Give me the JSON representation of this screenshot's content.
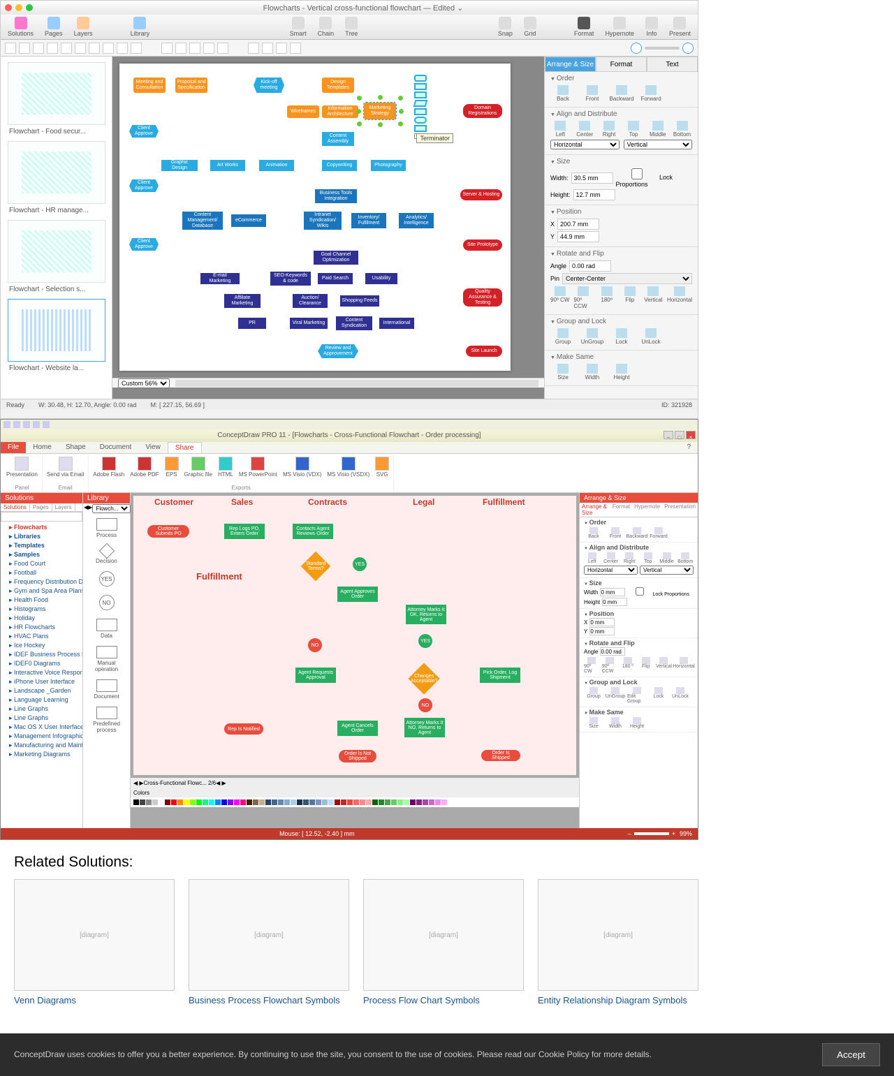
{
  "app1": {
    "title": "Flowcharts - Vertical cross-functional flowchart — Edited ⌄",
    "toolbar": [
      "Solutions",
      "Pages",
      "Layers",
      "Library",
      "Smart",
      "Chain",
      "Tree",
      "Snap",
      "Grid",
      "Format",
      "Hypernote",
      "Info",
      "Present"
    ],
    "thumbs": [
      "Flowchart - Food secur...",
      "Flowchart - HR manage...",
      "Flowchart - Selection s...",
      "Flowchart - Website la..."
    ],
    "tooltip": "Terminator",
    "rtabs": [
      "Arrange & Size",
      "Format",
      "Text"
    ],
    "panel": {
      "order": {
        "h": "Order",
        "btns": [
          "Back",
          "Front",
          "Backward",
          "Forward"
        ]
      },
      "align": {
        "h": "Align and Distribute",
        "btns": [
          "Left",
          "Center",
          "Right",
          "Top",
          "Middle",
          "Bottom"
        ],
        "h1": "Horizontal",
        "v1": "Vertical"
      },
      "size": {
        "h": "Size",
        "w": "Width:",
        "wv": "30.5 mm",
        "ht": "Height:",
        "hv": "12.7 mm",
        "lock": "Lock Proportions"
      },
      "pos": {
        "h": "Position",
        "x": "X",
        "xv": "200.7 mm",
        "y": "Y",
        "yv": "44.9 mm"
      },
      "rot": {
        "h": "Rotate and Flip",
        "a": "Angle",
        "av": "0.00 rad",
        "p": "Pin",
        "pv": "Center-Center",
        "btns": [
          "90º CW",
          "90º CCW",
          "180º",
          "Flip",
          "Vertical",
          "Horizontal"
        ]
      },
      "grp": {
        "h": "Group and Lock",
        "btns": [
          "Group",
          "UnGroup",
          "Lock",
          "UnLock"
        ]
      },
      "same": {
        "h": "Make Same",
        "btns": [
          "Size",
          "Width",
          "Height"
        ]
      }
    },
    "zoomcombo": "Custom 56%",
    "status": {
      "ready": "Ready",
      "dim": "W: 30.48,  H: 12.70,  Angle: 0.00 rad",
      "m": "M: [ 227.15, 56.69 ]",
      "id": "ID: 321928"
    },
    "nodes": {
      "r1": [
        "Meeting and Consultation",
        "Proposal and Specification",
        "Kick-off meeting",
        "Design Templates"
      ],
      "r2": [
        "Wireframes",
        "Information Architecture",
        "Marketing Strategy",
        "Domain Registrations"
      ],
      "ca1": "Client Approve",
      "ca2": "Client Approve",
      "ca3": "Client Approve",
      "content": "Content Assembly",
      "r3": [
        "Graphic Design",
        "Art Works",
        "Animation",
        "Copywriting",
        "Photography"
      ],
      "bti": "Business Tools Integration",
      "sh": "Server & Hosting",
      "r4": [
        "Content Management/ Database",
        "eCommerce",
        "Intranet Syndication/ Wikis",
        "Inventory/ Fulfilment",
        "Analytics/ Intelligence"
      ],
      "sp": "Site Prototype",
      "gco": "Goal Channel Optimization",
      "r5": [
        "E-mail Marketing",
        "SEO-Keywords & code",
        "Paid Search",
        "Usability"
      ],
      "qat": "Quality Assurance & Testing",
      "r6": [
        "Affiliate Marketing",
        "Auction/ Clearance",
        "Shopping Feeds"
      ],
      "r7": [
        "PR",
        "Viral Marketing",
        "Content Syndication",
        "International"
      ],
      "rev": "Review and Approvement",
      "sl": "Site Launch"
    }
  },
  "app2": {
    "title": "ConceptDraw PRO 11 - [Flowcharts - Cross-Functional Flowchart - Order processing]",
    "ribtabs": [
      "File",
      "Home",
      "Shape",
      "Document",
      "View",
      "Share"
    ],
    "ribbon": {
      "panel": [
        "Presentation",
        "Send via Email",
        "Adobe Flash",
        "Adobe PDF",
        "EPS",
        "Graphic file",
        "HTML",
        "MS PowerPoint",
        "MS Visio (VDX)",
        "MS Visio (VSDX)",
        "SVG"
      ],
      "groups": [
        "Panel",
        "Email",
        "Exports"
      ]
    },
    "solpane": {
      "h": "Solutions",
      "tabs": [
        "Solutions",
        "Pages",
        "Layers"
      ],
      "search": "",
      "tree": [
        "Flowcharts",
        "Libraries",
        "Templates",
        "Samples",
        "Food Court",
        "Football",
        "Frequency Distribution Dashboard",
        "Gym and Spa Area Plans",
        "Health Food",
        "Histograms",
        "Holiday",
        "HR Flowcharts",
        "HVAC Plans",
        "Ice Hockey",
        "IDEF Business Process Diagrams",
        "IDEF0 Diagrams",
        "Interactive Voice Response Diagrams",
        "iPhone User Interface",
        "Landscape _Garden",
        "Language Learning",
        "Line Graphs",
        "Line Graphs",
        "Mac OS X User Interface",
        "Management Infographics",
        "Manufacturing and Maintenance",
        "Marketing Diagrams"
      ]
    },
    "libpane": {
      "h": "Library",
      "combo": "Flowch...",
      "items": [
        "Process",
        "Decision",
        "YES",
        "NO",
        "Data",
        "Manual operation",
        "Document",
        "Predefined process"
      ]
    },
    "lanes": [
      "Customer",
      "Sales",
      "Contracts",
      "Legal",
      "Fulfillment"
    ],
    "fulfillment": "Fulfillment",
    "nodes": {
      "cs": "Customer Submits PO",
      "rl": "Rep Logs PO, Enters Order",
      "ca": "Contacts Agent Reviews Order",
      "st": "Standard Terms?",
      "yes": "YES",
      "aa": "Agent Approves Order",
      "am": "Attorney Marks It OK, Returns to Agent",
      "yes2": "YES",
      "no": "NO",
      "ar": "Agent Requests Approval",
      "chg": "Changes Acceptable?",
      "po": "Pick Order, Log Shipment",
      "no2": "NO",
      "rn": "Rep Is Notified",
      "ac": "Agent Cancels Order",
      "am2": "Attorney Marks It NO, Returns to Agent",
      "ons": "Order Is Not Shipped",
      "ois": "Order Is Shipped"
    },
    "tabstrip": "Cross-Functional Flowc... 2/6",
    "colors": "Colors",
    "rpanel": {
      "h": "Arrange & Size",
      "tabs": [
        "Arrange & Size",
        "Format",
        "Hypernote",
        "Presentation"
      ],
      "order": {
        "h": "Order",
        "btns": [
          "Back",
          "Front",
          "Backward",
          "Forward"
        ]
      },
      "align": {
        "h": "Align and Distribute",
        "btns": [
          "Left",
          "Center",
          "Right",
          "Top",
          "Middle",
          "Bottom"
        ],
        "hv": "Horizontal",
        "vv": "Vertical"
      },
      "size": {
        "h": "Size",
        "w": "Width",
        "wv": "0 mm",
        "ht": "Height",
        "hv": "0 mm",
        "lock": "Lock Proportions"
      },
      "pos": {
        "h": "Position",
        "x": "X",
        "xv": "0 mm",
        "y": "Y",
        "yv": "0 mm"
      },
      "rot": {
        "h": "Rotate and Flip",
        "a": "Angle",
        "av": "0.00 rad",
        "btns": [
          "90º CW",
          "90º CCW",
          "180 º",
          "Flip",
          "Vertical",
          "Horizontal"
        ]
      },
      "grp": {
        "h": "Group and Lock",
        "btns": [
          "Group",
          "UnGroup",
          "Edit Group",
          "Lock",
          "UnLock"
        ]
      },
      "same": {
        "h": "Make Same",
        "btns": [
          "Size",
          "Width",
          "Height"
        ]
      }
    },
    "status": {
      "mouse": "Mouse: [ 12.52, -2.40 ] mm",
      "zoom": "99%"
    }
  },
  "related": {
    "h": "Related Solutions:",
    "items": [
      {
        "t": "Venn Diagrams",
        "i": "thumb"
      },
      {
        "t": "Business Process Flowchart Symbols",
        "i": "thumb"
      },
      {
        "t": "Process Flow Chart Symbols",
        "i": "thumb"
      },
      {
        "t": "Entity Relationship Diagram Symbols",
        "i": "thumb"
      }
    ]
  },
  "cookie": {
    "text": "ConceptDraw uses cookies to offer you a better experience. By continuing to use the site, you consent to the use of cookies. Please read our Cookie Policy for more details.",
    "btn": "Accept"
  }
}
